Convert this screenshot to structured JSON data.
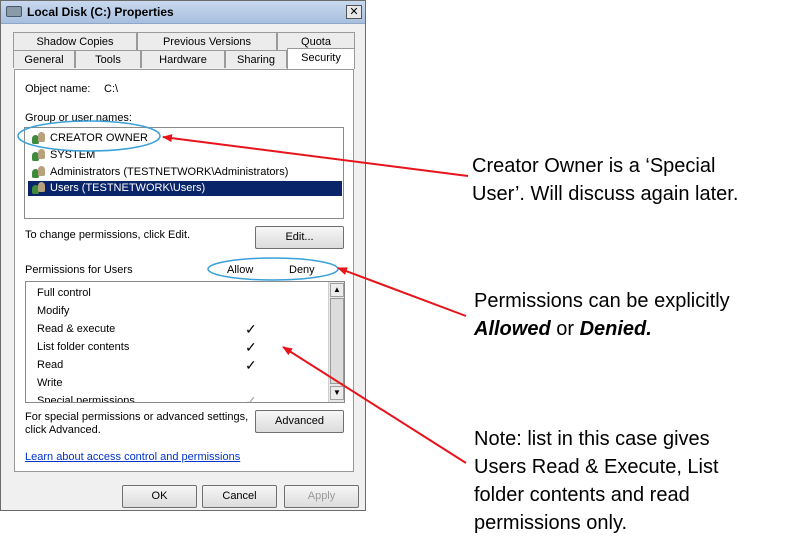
{
  "window": {
    "title": "Local Disk (C:) Properties",
    "close_glyph": "✕"
  },
  "tabs": {
    "row_top": [
      "Shadow Copies",
      "Previous Versions",
      "Quota"
    ],
    "row_bottom": [
      "General",
      "Tools",
      "Hardware",
      "Sharing",
      "Security"
    ],
    "active": "Security"
  },
  "object": {
    "label": "Object name:",
    "value": "C:\\"
  },
  "groups": {
    "label": "Group or user names:",
    "items": [
      "CREATOR OWNER",
      "SYSTEM",
      "Administrators (TESTNETWORK\\Administrators)",
      "Users (TESTNETWORK\\Users)"
    ],
    "selected_index": 3
  },
  "change_hint": "To change permissions, click Edit.",
  "edit_label": "Edit...",
  "permissions": {
    "label": "Permissions for Users",
    "allow_header": "Allow",
    "deny_header": "Deny",
    "rows": [
      {
        "name": "Full control",
        "allow": ""
      },
      {
        "name": "Modify",
        "allow": ""
      },
      {
        "name": "Read & execute",
        "allow": "✓"
      },
      {
        "name": "List folder contents",
        "allow": "✓"
      },
      {
        "name": "Read",
        "allow": "✓"
      },
      {
        "name": "Write",
        "allow": ""
      },
      {
        "name": "Special permissions",
        "allow": "✓"
      }
    ]
  },
  "special_hint": {
    "line1": "For special permissions or advanced settings,",
    "line2": "click Advanced."
  },
  "advanced_label": "Advanced",
  "learn_link": "Learn about access control and permissions",
  "footer": {
    "ok": "OK",
    "cancel": "Cancel",
    "apply": "Apply"
  },
  "annotations": {
    "creator": {
      "line1": "Creator Owner is a ‘Special",
      "line2": "User’. Will discuss again later."
    },
    "permissions": {
      "line1": "Permissions can be explicitly",
      "allowed": "Allowed",
      "or": " or ",
      "denied": "Denied."
    },
    "note": {
      "line1": "Note: list in this case gives",
      "line2": "Users Read & Execute, List",
      "line3": "folder contents and read",
      "line4": "permissions only."
    }
  },
  "colors": {
    "arrow": "#e8141c",
    "highlight_ellipse": "#3aa0d8",
    "selection": "#0a246a",
    "link": "#0033cc"
  }
}
